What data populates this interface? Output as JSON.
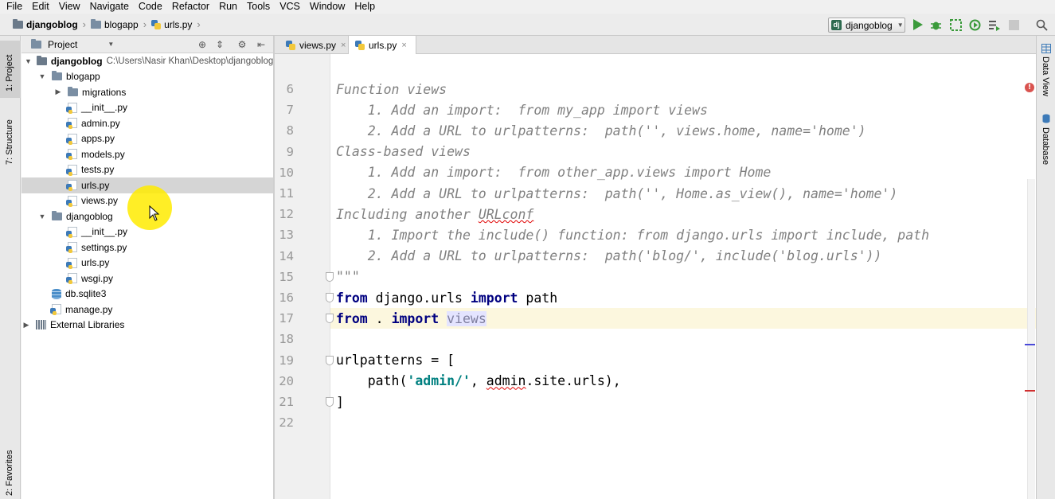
{
  "menu": [
    "File",
    "Edit",
    "View",
    "Navigate",
    "Code",
    "Refactor",
    "Run",
    "Tools",
    "VCS",
    "Window",
    "Help"
  ],
  "breadcrumb": [
    "djangoblog",
    "blogapp",
    "urls.py"
  ],
  "run_config": "djangoblog",
  "left_tools": {
    "project": "1: Project",
    "structure": "7: Structure",
    "favorites": "2: Favorites"
  },
  "right_tools": {
    "data_view": "Data View",
    "database": "Database"
  },
  "project_panel": {
    "title": "Project"
  },
  "tree": {
    "root": {
      "name": "djangoblog",
      "path": "C:\\Users\\Nasir Khan\\Desktop\\djangoblog"
    },
    "blogapp": {
      "name": "blogapp",
      "children": [
        "migrations",
        "__init__.py",
        "admin.py",
        "apps.py",
        "models.py",
        "tests.py",
        "urls.py",
        "views.py"
      ]
    },
    "djangoblog_pkg": {
      "name": "djangoblog",
      "children": [
        "__init__.py",
        "settings.py",
        "urls.py",
        "wsgi.py"
      ]
    },
    "db": "db.sqlite3",
    "manage": "manage.py",
    "external": "External Libraries"
  },
  "tabs": [
    {
      "label": "views.py",
      "close": "×"
    },
    {
      "label": "urls.py",
      "close": "×"
    }
  ],
  "editor": {
    "line_numbers": [
      "6",
      "7",
      "8",
      "9",
      "10",
      "11",
      "12",
      "13",
      "14",
      "15",
      "16",
      "17",
      "18",
      "19",
      "20",
      "21",
      "22"
    ],
    "lines": {
      "l6": "Function views",
      "l7": "    1. Add an import:  from my_app import views",
      "l8": "    2. Add a URL to urlpatterns:  path('', views.home, name='home')",
      "l9": "Class-based views",
      "l10": "    1. Add an import:  from other_app.views import Home",
      "l11": "    2. Add a URL to urlpatterns:  path('', Home.as_view(), name='home')",
      "l12a": "Including another ",
      "l12b": "URLconf",
      "l13": "    1. Import the include() function: from django.urls import include, path",
      "l14": "    2. Add a URL to urlpatterns:  path('blog/', include('blog.urls'))",
      "l15": "\"\"\"",
      "l16": {
        "kw1": "from",
        "mod": " django.urls ",
        "kw2": "import",
        "name": " path"
      },
      "l17": {
        "kw1": "from",
        "mod": " . ",
        "kw2": "import",
        "name": "views"
      },
      "l19": "urlpatterns = [",
      "l20": {
        "pre": "    path(",
        "str": "'admin/'",
        "mid": ", ",
        "err": "admin",
        "post": ".site.urls),"
      },
      "l21": "]"
    },
    "error_badge": "!"
  }
}
